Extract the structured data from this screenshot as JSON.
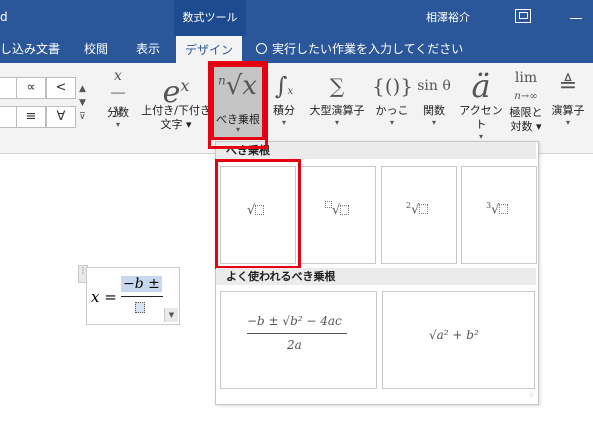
{
  "title_bar": {
    "first_letter": "d",
    "context_group": "数式ツール",
    "user_name": "相澤裕介"
  },
  "tabs": [
    {
      "label": "し込み文書"
    },
    {
      "label": "校閲"
    },
    {
      "label": "表示"
    },
    {
      "label": "デザイン"
    }
  ],
  "tell_me": "実行したい作業を入力してください",
  "symbols": [
    "∝",
    "<",
    "≡",
    "∀"
  ],
  "ribbon": {
    "fraction": {
      "label": "分数"
    },
    "script": {
      "label1": "上付き/下付き",
      "label2": "文字"
    },
    "radical": {
      "label": "べき乗根"
    },
    "integral": {
      "label": "積分"
    },
    "large_operator": {
      "label": "大型演算子"
    },
    "bracket": {
      "label": "かっこ"
    },
    "function": {
      "label": "関数",
      "glyph": "sin θ"
    },
    "accent": {
      "label": "アクセント"
    },
    "limit_log": {
      "label1": "極限と",
      "label2": "対数"
    },
    "operator": {
      "label": "演算子"
    }
  },
  "dropdown": {
    "section1": "べき乗根",
    "section2": "よく使われるべき乗根",
    "common1": "−b ± √b² − 4ac",
    "common1_den": "2a",
    "common2": "√a² + b²"
  },
  "equation": {
    "lhs": "x =",
    "numerator": "−b ±"
  },
  "colors": {
    "title_bar": "#2b579a",
    "highlight": "#e60012"
  }
}
